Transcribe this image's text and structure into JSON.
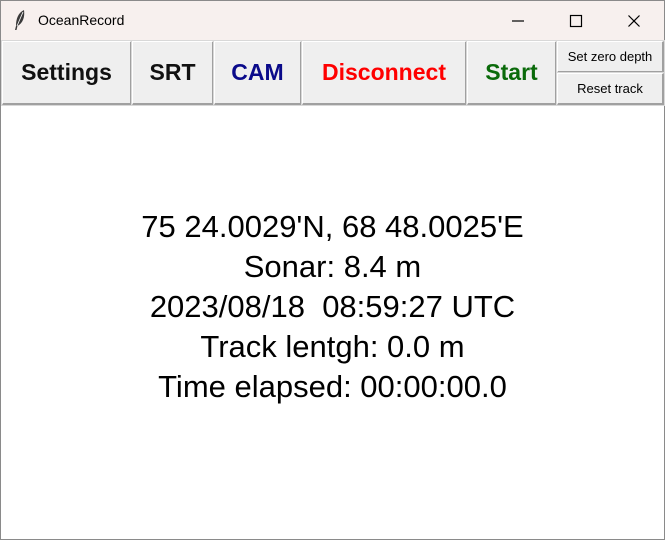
{
  "window": {
    "title": "OceanRecord",
    "app_icon": "feather-icon",
    "controls": {
      "minimize_icon": "minimize-icon",
      "maximize_icon": "maximize-icon",
      "close_icon": "close-icon"
    }
  },
  "toolbar": {
    "settings_label": "Settings",
    "srt_label": "SRT",
    "cam_label": "CAM",
    "disconnect_label": "Disconnect",
    "start_label": "Start",
    "set_zero_depth_label": "Set zero depth",
    "reset_track_label": "Reset track",
    "colors": {
      "default": "#111111",
      "cam": "#0a0a8a",
      "disconnect": "#ff0000",
      "start": "#0a6a0a"
    }
  },
  "status": {
    "position": "75 24.0029'N, 68 48.0025'E",
    "sonar": "Sonar: 8.4 m",
    "datetime": "2023/08/18  08:59:27 UTC",
    "track_length": "Track lentgh: 0.0 m",
    "time_elapsed": "Time elapsed: 00:00:00.0"
  }
}
